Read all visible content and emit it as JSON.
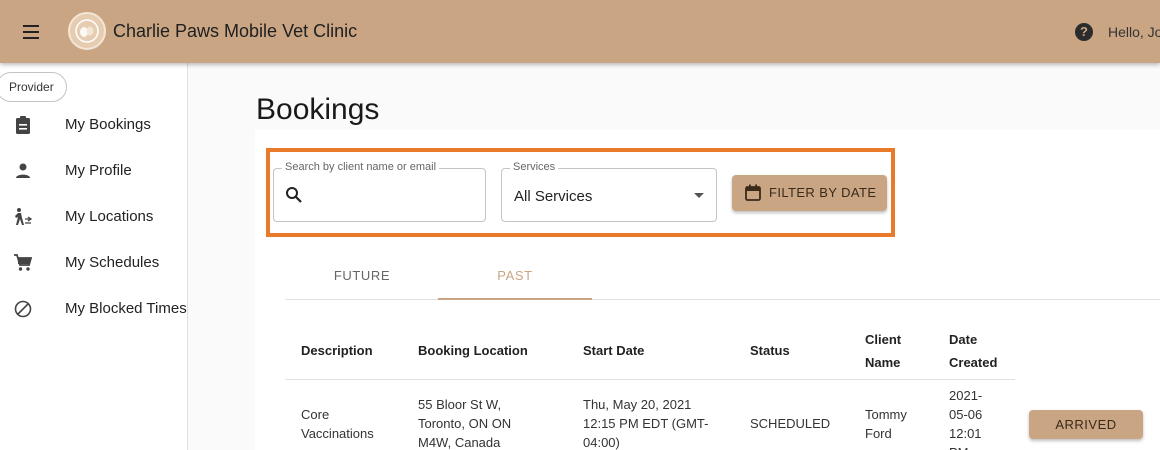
{
  "app": {
    "title": "Charlie Paws Mobile Vet Clinic",
    "greeting": "Hello, Jo",
    "brand_color": "#c9a584",
    "highlight_color": "#e87a29"
  },
  "sidebar": {
    "role_chip": "Provider",
    "items": [
      {
        "label": "My Bookings",
        "icon": "clipboard-icon"
      },
      {
        "label": "My Profile",
        "icon": "person-icon"
      },
      {
        "label": "My Locations",
        "icon": "walking-person-icon"
      },
      {
        "label": "My Schedules",
        "icon": "shopping-cart-icon"
      },
      {
        "label": "My Blocked Times",
        "icon": "block-icon"
      }
    ]
  },
  "main": {
    "title": "Bookings",
    "search": {
      "legend": "Search by client name or email",
      "value": ""
    },
    "services": {
      "legend": "Services",
      "selected": "All Services"
    },
    "filter_button": "FILTER BY DATE",
    "tabs": [
      {
        "label": "FUTURE",
        "active": false
      },
      {
        "label": "PAST",
        "active": true
      }
    ],
    "table": {
      "headers": {
        "description": "Description",
        "location": "Booking Location",
        "start": "Start Date",
        "status": "Status",
        "client_1": "Client",
        "client_2": "Name",
        "created_1": "Date",
        "created_2": "Created"
      },
      "row": {
        "description_1": "Core",
        "description_2": "Vaccinations",
        "location_1": "55 Bloor St W,",
        "location_2": "Toronto, ON ON",
        "location_3": "M4W, Canada",
        "start_1": "Thu, May 20, 2021",
        "start_2": "12:15 PM EDT (GMT-",
        "start_3": "04:00)",
        "status": "SCHEDULED",
        "client_1": "Tommy",
        "client_2": "Ford",
        "created_1": "2021-",
        "created_2": "05-06",
        "created_3": "12:01",
        "created_4": "PM",
        "action": "ARRIVED"
      }
    }
  }
}
